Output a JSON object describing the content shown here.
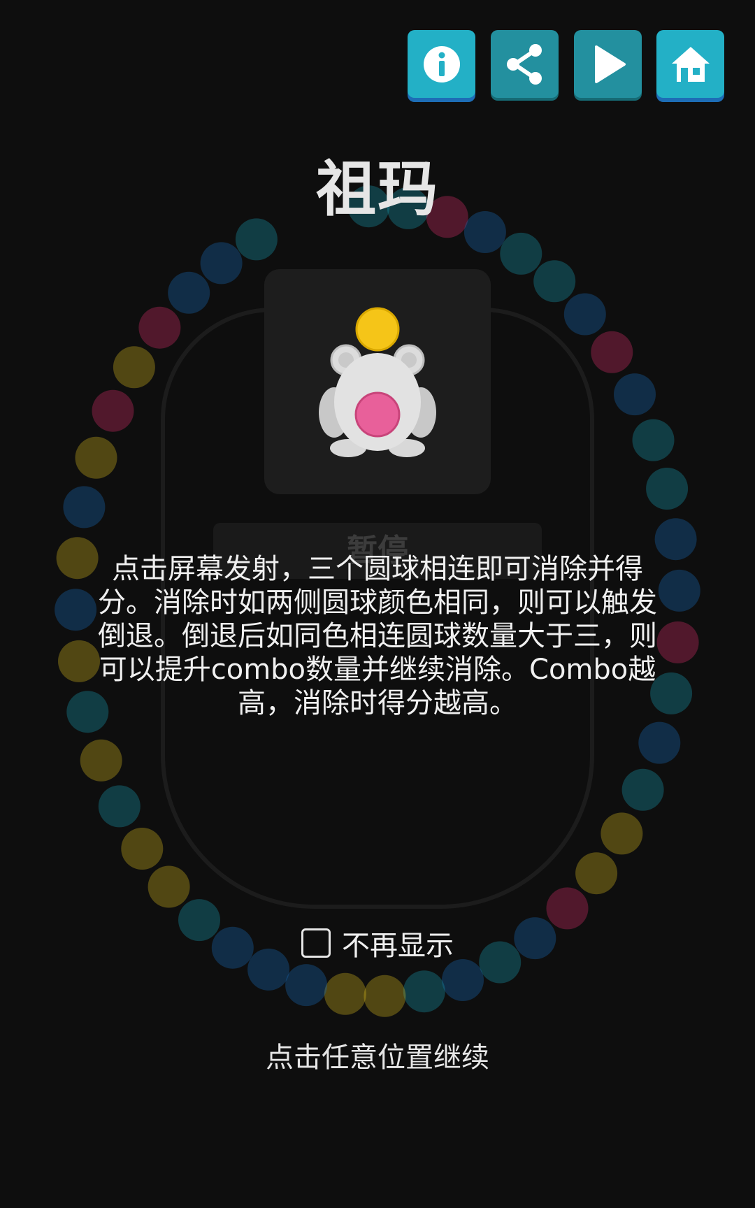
{
  "toolbar": {
    "buttons": [
      {
        "name": "info-button",
        "icon": "info-icon",
        "color": "#23b0c6"
      },
      {
        "name": "share-button",
        "icon": "share-icon",
        "color": "#23909f"
      },
      {
        "name": "play-button",
        "icon": "play-icon",
        "color": "#23909f"
      },
      {
        "name": "home-button",
        "icon": "home-icon",
        "color": "#23b0c6"
      }
    ]
  },
  "dialog": {
    "title": "祖玛",
    "illustration": "frog-shooter-icon",
    "description": "点击屏幕发射，三个圆球相连即可消除并得分。消除时如两侧圆球颜色相同，则可以触发倒退。倒退后如同色相连圆球数量大于三，则可以提升combo数量并继续消除。Combo越高，消除时得分越高。",
    "dont_show_again_label": "不再显示",
    "dont_show_again_checked": false,
    "continue_hint": "点击任意位置继续"
  },
  "background": {
    "pause_label": "暂停",
    "ball_colors": [
      "#1aa3b8",
      "#e0c020",
      "#e0306e",
      "#1a6fc0"
    ]
  }
}
